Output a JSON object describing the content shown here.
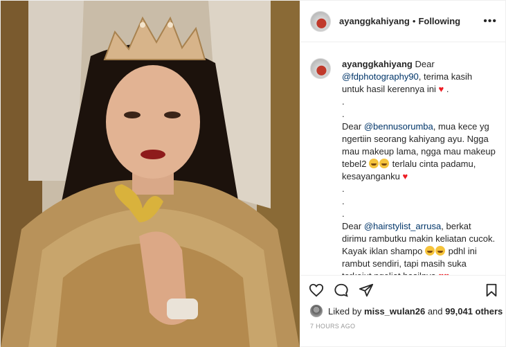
{
  "post": {
    "username": "ayanggkahiyang",
    "follow_status": "Following",
    "separator": "•"
  },
  "caption": {
    "username": "ayanggkahiyang",
    "p1_a": "Dear",
    "p1_mention": "@fdphotography90",
    "p1_b": ", terima kasih untuk hasil kerennya ini",
    "p1_end": ".",
    "dot": ".",
    "p2_a": "Dear",
    "p2_mention": "@bennusorumba",
    "p2_b": ", mua kece yg ngertiin seorang kahiyang ayu. Ngga mau makeup lama, ngga mau makeup tebel2",
    "p2_c": "terlalu cinta padamu, kesayanganku",
    "p3_a": "Dear",
    "p3_mention": "@hairstylist_arrusa",
    "p3_b": ", berkat dirimu rambutku makin keliatan cucok. Kayak iklan shampo",
    "p3_c": "pdhl ini rambut sendiri, tapi masih suka terkejut ngeliat hasilnya",
    "heart_glyph": "♥"
  },
  "likes": {
    "prefix": "Liked by",
    "user": "miss_wulan26",
    "middle": "and",
    "count": "99,041 others"
  },
  "timestamp": "7 HOURS AGO",
  "icons": {
    "more": "more-horizontal-icon",
    "like": "heart-outline-icon",
    "comment": "comment-bubble-icon",
    "share": "share-plane-icon",
    "save": "bookmark-icon"
  },
  "colors": {
    "text": "#262626",
    "mention": "#003569",
    "heart": "#ed1c24",
    "muted": "#999999",
    "border": "#efefef"
  }
}
